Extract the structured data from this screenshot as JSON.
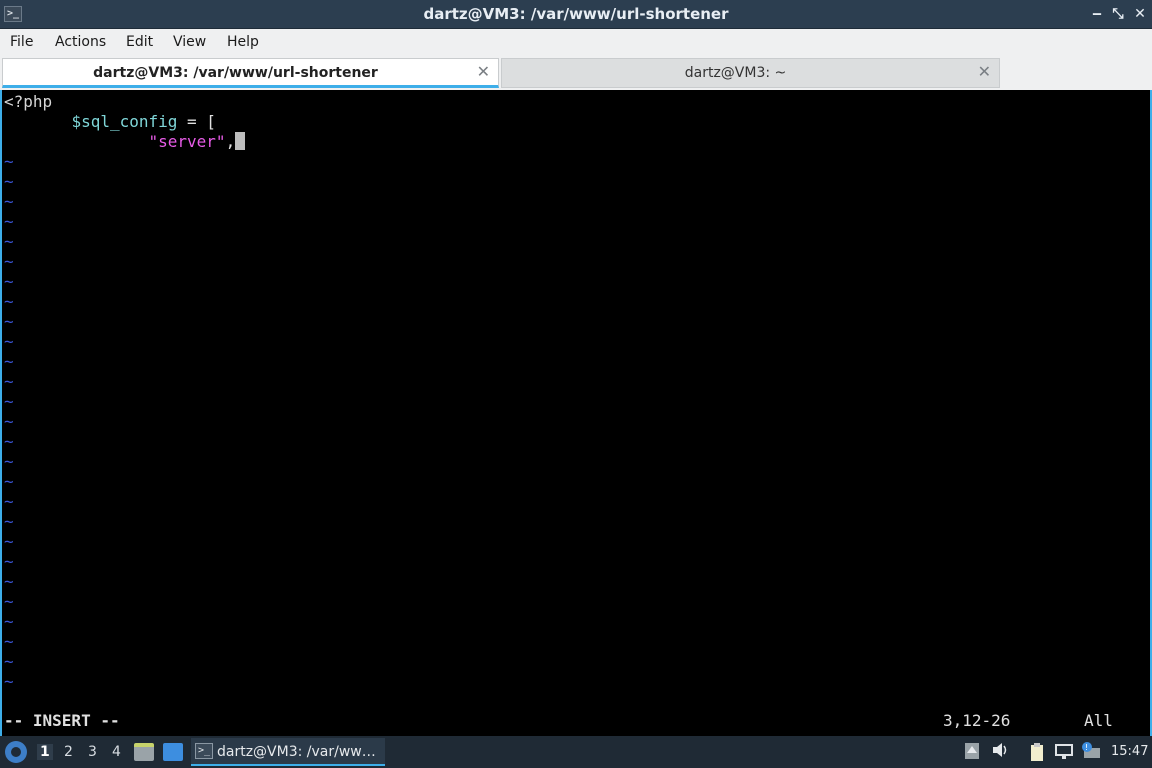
{
  "window": {
    "title": "dartz@VM3: /var/www/url-shortener",
    "app_icon_glyph": ">_",
    "minimize_glyph": "‒",
    "maximize_glyph": "⤡",
    "close_glyph": "✕"
  },
  "menubar": {
    "items": [
      "File",
      "Actions",
      "Edit",
      "View",
      "Help"
    ]
  },
  "tabs": [
    {
      "label": "dartz@VM3: /var/www/url-shortener",
      "active": true,
      "close_glyph": "✕"
    },
    {
      "label": "dartz@VM3: ~",
      "active": false,
      "close_glyph": "✕"
    }
  ],
  "editor": {
    "lines": {
      "l1": "<?php",
      "l2_indent": "       ",
      "l2_var": "$sql_config",
      "l2_rest": " = [",
      "l3_indent": "               ",
      "l3_str": "\"server\"",
      "l3_rest": ","
    },
    "tilde": "~",
    "status": {
      "mode": "-- INSERT --",
      "position": "3,12-26",
      "scroll": "All"
    },
    "colors": {
      "variable": "#7fd6d8",
      "string": "#e85ce8",
      "tilde": "#3a56d8"
    }
  },
  "taskbar": {
    "workspaces": [
      "1",
      "2",
      "3",
      "4"
    ],
    "active_workspace": "1",
    "task_label": "dartz@VM3: /var/ww…",
    "task_icon_glyph": ">_",
    "clock": "15:47",
    "tray_icons": [
      "upload-icon",
      "volume-icon",
      "clipboard-icon",
      "network-icon",
      "updates-icon"
    ]
  }
}
